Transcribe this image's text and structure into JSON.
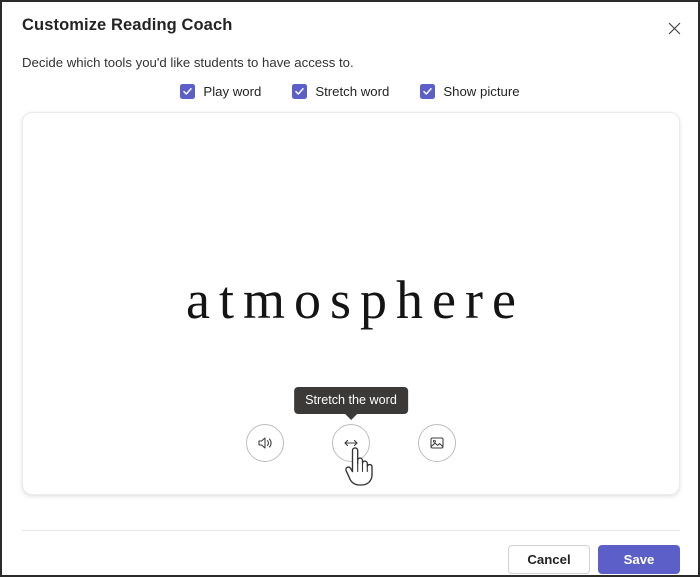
{
  "dialog": {
    "title": "Customize Reading Coach",
    "subtitle": "Decide which tools you'd like students to have access to.",
    "close_icon": "close-icon"
  },
  "options": [
    {
      "label": "Play word",
      "checked": true,
      "icon": "checkmark-icon"
    },
    {
      "label": "Stretch word",
      "checked": true,
      "icon": "checkmark-icon"
    },
    {
      "label": "Show picture",
      "checked": true,
      "icon": "checkmark-icon"
    }
  ],
  "preview": {
    "word": "atmosphere",
    "tooltip": "Stretch the word",
    "tools": [
      {
        "name": "play-word-button",
        "icon": "speaker-icon"
      },
      {
        "name": "stretch-word-button",
        "icon": "double-arrow-icon"
      },
      {
        "name": "show-picture-button",
        "icon": "image-icon"
      }
    ],
    "cursor": "pointing-hand-cursor"
  },
  "footer": {
    "cancel_label": "Cancel",
    "save_label": "Save"
  },
  "colors": {
    "accent": "#5b5fc7",
    "tooltip_bg": "#3b3a39",
    "text": "#242424",
    "border": "#e6e6e6"
  }
}
